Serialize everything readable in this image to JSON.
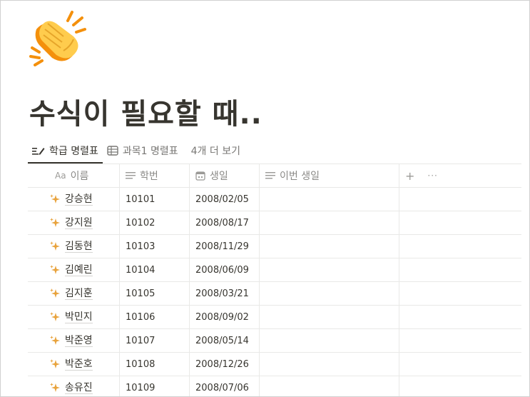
{
  "page": {
    "title": "수식이 필요할 때..",
    "icon": "clapping-hands-icon"
  },
  "tabs": [
    {
      "label": "학급 명렬표",
      "icon": "pencil-list-icon",
      "active": true
    },
    {
      "label": "과목1 명렬표",
      "icon": "table-icon",
      "active": false
    },
    {
      "label": "4개 더 보기",
      "icon": "",
      "active": false
    }
  ],
  "table": {
    "columns": [
      {
        "label": "이름",
        "icon": "aa-title-icon"
      },
      {
        "label": "학번",
        "icon": "text-lines-icon"
      },
      {
        "label": "생일",
        "icon": "calendar-icon"
      },
      {
        "label": "이번 생일",
        "icon": "text-lines-icon"
      }
    ],
    "add_label": "+",
    "more_label": "···",
    "rows": [
      {
        "name": "강승현",
        "id": "10101",
        "birthday": "2008/02/05",
        "this_birthday": ""
      },
      {
        "name": "강지원",
        "id": "10102",
        "birthday": "2008/08/17",
        "this_birthday": ""
      },
      {
        "name": "김동현",
        "id": "10103",
        "birthday": "2008/11/29",
        "this_birthday": ""
      },
      {
        "name": "김예린",
        "id": "10104",
        "birthday": "2008/06/09",
        "this_birthday": ""
      },
      {
        "name": "김지훈",
        "id": "10105",
        "birthday": "2008/03/21",
        "this_birthday": ""
      },
      {
        "name": "박민지",
        "id": "10106",
        "birthday": "2008/09/02",
        "this_birthday": ""
      },
      {
        "name": "박준영",
        "id": "10107",
        "birthday": "2008/05/14",
        "this_birthday": ""
      },
      {
        "name": "박준호",
        "id": "10108",
        "birthday": "2008/12/26",
        "this_birthday": ""
      },
      {
        "name": "송유진",
        "id": "10109",
        "birthday": "2008/07/06",
        "this_birthday": ""
      }
    ]
  },
  "colors": {
    "text": "#37352f",
    "muted": "#787774",
    "border": "#e9e9e7",
    "sparkle": "#e8a33d",
    "emoji_yellow": "#ffcc4d",
    "emoji_orange": "#f4900c"
  }
}
